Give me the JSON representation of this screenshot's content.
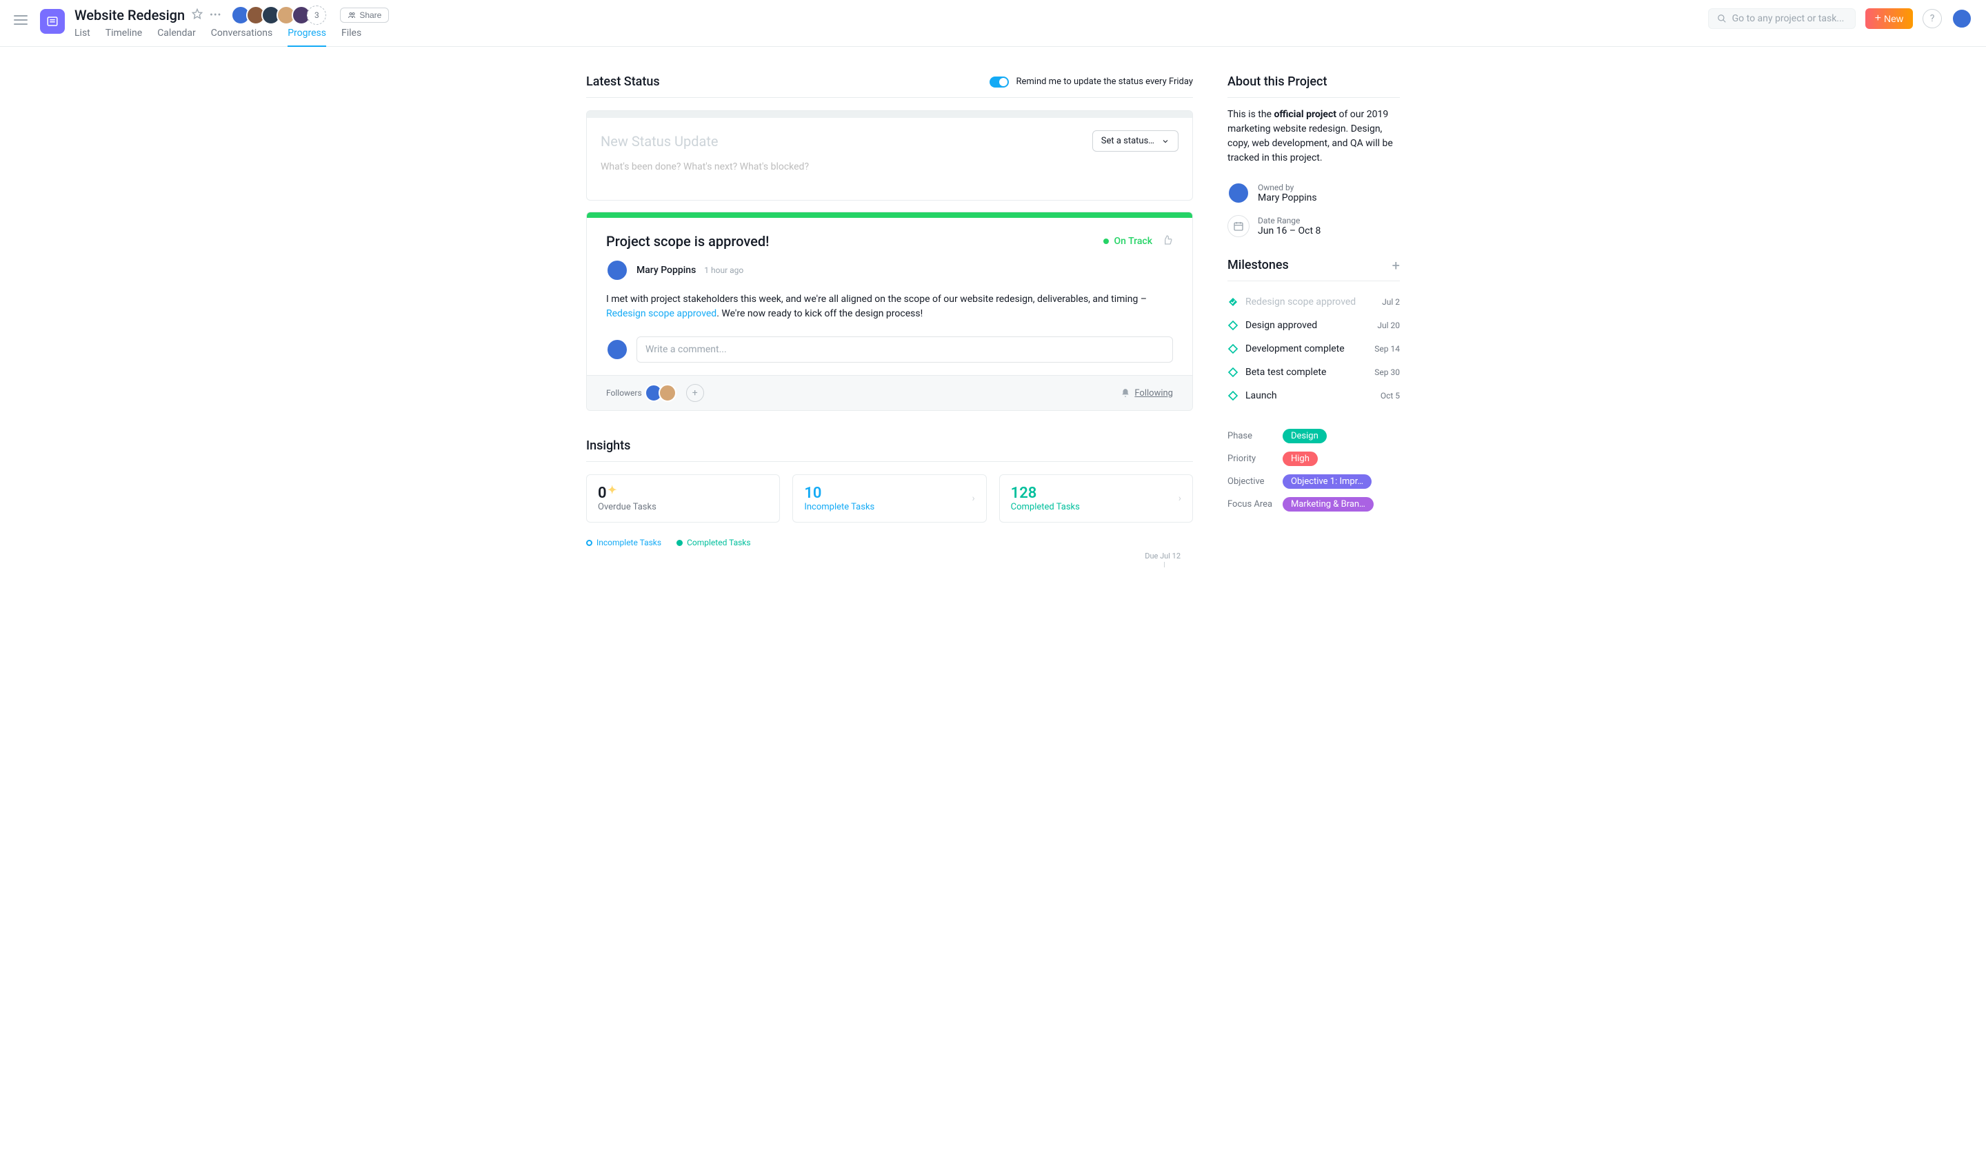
{
  "header": {
    "title": "Website Redesign",
    "member_overflow": "3",
    "share_label": "Share",
    "search_placeholder": "Go to any project or task...",
    "new_label": "New",
    "tabs": [
      "List",
      "Timeline",
      "Calendar",
      "Conversations",
      "Progress",
      "Files"
    ],
    "active_tab": "Progress"
  },
  "status": {
    "section_title": "Latest Status",
    "remind_label": "Remind me to update the status every Friday",
    "compose_title": "New Status Update",
    "set_status_label": "Set a status…",
    "compose_placeholder": "What's been done? What's next? What's blocked?",
    "card": {
      "title": "Project scope is approved!",
      "badge": "On Track",
      "author": "Mary Poppins",
      "timestamp": "1 hour ago",
      "body_pre": "I met with project stakeholders this week, and we're all aligned on the scope of our website redesign, deliverables, and timing – ",
      "body_link": "Redesign scope approved",
      "body_post": ". We're now ready to kick off the design process!",
      "comment_placeholder": "Write a comment...",
      "followers_label": "Followers",
      "following_label": "Following"
    }
  },
  "insights": {
    "section_title": "Insights",
    "cards": [
      {
        "value": "0",
        "label": "Overdue Tasks"
      },
      {
        "value": "10",
        "label": "Incomplete Tasks"
      },
      {
        "value": "128",
        "label": "Completed Tasks"
      }
    ],
    "legend": [
      "Incomplete Tasks",
      "Completed Tasks"
    ],
    "due_label": "Due Jul 12"
  },
  "about": {
    "section_title": "About this Project",
    "body_pre": "This is the ",
    "body_bold": "official project",
    "body_post": " of our 2019 marketing website redesign. Design, copy, web development, and QA will be tracked in this project.",
    "owned_by_label": "Owned by",
    "owner_name": "Mary Poppins",
    "date_range_label": "Date Range",
    "date_range": "Jun 16 – Oct 8"
  },
  "milestones": {
    "section_title": "Milestones",
    "items": [
      {
        "label": "Redesign scope approved",
        "date": "Jul 2",
        "done": true
      },
      {
        "label": "Design approved",
        "date": "Jul 20",
        "done": false
      },
      {
        "label": "Development complete",
        "date": "Sep 14",
        "done": false
      },
      {
        "label": "Beta test complete",
        "date": "Sep 30",
        "done": false
      },
      {
        "label": "Launch",
        "date": "Oct 5",
        "done": false
      }
    ]
  },
  "custom_fields": {
    "rows": [
      {
        "label": "Phase",
        "value": "Design",
        "pill": "pill-teal"
      },
      {
        "label": "Priority",
        "value": "High",
        "pill": "pill-red"
      },
      {
        "label": "Objective",
        "value": "Objective 1: Impr…",
        "pill": "pill-purple"
      },
      {
        "label": "Focus Area",
        "value": "Marketing & Bran…",
        "pill": "pill-magenta"
      }
    ]
  }
}
